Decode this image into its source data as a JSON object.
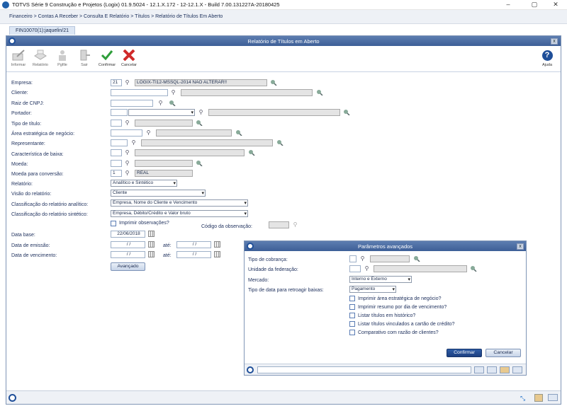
{
  "app_title": "TOTVS Série 9 Construção e Projetos (Logix) 01.9.5024 - 12.1.X.172 - 12-12.1.X - Build 7.00.131227A-20180425",
  "window_controls": {
    "minimize": "–",
    "maximize": "▢",
    "close": "✕"
  },
  "breadcrumb": "Financeiro > Contas A Receber > Consulta E Relatório > Títulos > Relatório de Títulos Em Aberto",
  "tab_label": "FIN10070(1):jaquelin/21",
  "window_title": "Relatório de Títulos em Aberto",
  "close_glyph": "x",
  "toolbar": [
    {
      "name": "informar",
      "label": "Informar",
      "enabled": false
    },
    {
      "name": "relatorio",
      "label": "Relatório",
      "enabled": false
    },
    {
      "name": "pagfile",
      "label": "Pgfile",
      "enabled": false
    },
    {
      "name": "sair",
      "label": "Sair",
      "enabled": false
    },
    {
      "name": "confirmar",
      "label": "Confirmar",
      "enabled": true
    },
    {
      "name": "cancelar",
      "label": "Cancelar",
      "enabled": true
    }
  ],
  "help_label": "Ajuda",
  "help_glyph": "?",
  "form": {
    "empresa": {
      "label": "Empresa:",
      "code": "21",
      "desc": "LOGIX-TI12-MSSQL-2014 NÃO ALTERAR!!"
    },
    "cliente": {
      "label": "Cliente:",
      "value": "",
      "desc": ""
    },
    "raiz_cnpj": {
      "label": "Raiz de CNPJ:",
      "value": ""
    },
    "portador": {
      "label": "Portador:",
      "value": "",
      "type": "",
      "desc": ""
    },
    "tipo_titulo": {
      "label": "Tipo de título:",
      "value": "",
      "desc": ""
    },
    "area": {
      "label": "Área estratégica de negócio:",
      "value": "",
      "desc": ""
    },
    "representante": {
      "label": "Representante:",
      "value": "",
      "desc": ""
    },
    "caract_baixa": {
      "label": "Característica de baixa:",
      "value": "",
      "desc": ""
    },
    "moeda": {
      "label": "Moeda:",
      "value": "",
      "desc": ""
    },
    "moeda_conversao": {
      "label": "Moeda para conversão:",
      "code": "1",
      "desc": "REAL"
    },
    "relatorio": {
      "label": "Relatório:",
      "value": "Analítico e Sintético"
    },
    "visao": {
      "label": "Visão do relatório:",
      "value": "Cliente"
    },
    "class_analitico": {
      "label": "Classificação do relatório analítico:",
      "value": "Empresa, Nome do Cliente e Vencimento"
    },
    "class_sintetico": {
      "label": "Classificação do relatório sintético:",
      "value": "Empresa, Débito/Crédito e Valor bruto"
    },
    "imprimir_obs": {
      "label": "Imprimir observações?",
      "checked": false
    },
    "codigo_obs": {
      "label": "Código da observação:",
      "value": ""
    },
    "data_base": {
      "label": "Data base:",
      "value": "22/06/2018"
    },
    "data_emissao": {
      "label": "Data de emissão:",
      "from": " / /",
      "ate_label": "até:",
      "to": " / /"
    },
    "data_vencimento": {
      "label": "Data de vencimento:",
      "from": " / /",
      "ate_label": "até:",
      "to": " / /"
    },
    "avancado_label": "Avançado"
  },
  "dialog": {
    "title": "Parâmetros avançados",
    "tipo_cobranca": {
      "label": "Tipo de cobrança:",
      "value": "",
      "desc": ""
    },
    "uf": {
      "label": "Unidade da federação:",
      "value": "",
      "desc": ""
    },
    "mercado": {
      "label": "Mercado:",
      "value": "Interno e Externo"
    },
    "tipo_data": {
      "label": "Tipo de data para retroagir baixas:",
      "value": "Pagamento"
    },
    "options": [
      {
        "label": "Imprimir área estratégica de negócio?",
        "checked": false
      },
      {
        "label": "Imprimir resumo por dia de vencimento?",
        "checked": false
      },
      {
        "label": "Listar títulos em histórico?",
        "checked": false
      },
      {
        "label": "Listar títulos vinculados a cartão de crédito?",
        "checked": false
      },
      {
        "label": "Comparativo com razão de clientes?",
        "checked": false
      }
    ],
    "confirm_label": "Confirmar",
    "cancel_label": "Cancelar"
  },
  "colors": {
    "title_bar": "#3d5f97",
    "primary_button": "#1c3f80",
    "confirm_icon": "#2e9e3a",
    "cancel_icon": "#d02a2a"
  }
}
